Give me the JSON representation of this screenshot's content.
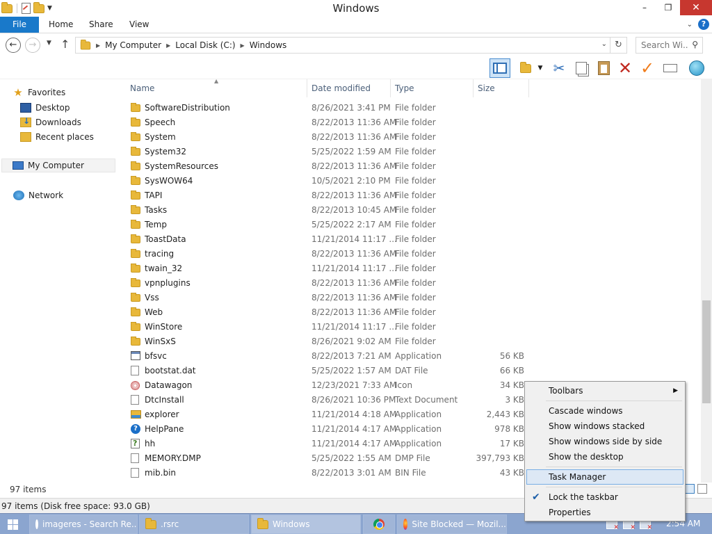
{
  "window": {
    "title": "Windows",
    "minimize_glyph": "–",
    "maximize_glyph": "❐",
    "close_glyph": "✕"
  },
  "ribbon": {
    "tabs": [
      "File",
      "Home",
      "Share",
      "View"
    ]
  },
  "address": {
    "breadcrumbs": [
      "My Computer",
      "Local Disk (C:)",
      "Windows"
    ],
    "search_placeholder": "Search Wi..."
  },
  "toolbar": {
    "icons": [
      "layout-pane-icon",
      "new-folder-icon",
      "cut-icon",
      "copy-icon",
      "paste-icon",
      "delete-icon",
      "properties-check-icon",
      "rename-icon",
      "globe-icon"
    ]
  },
  "navpane": {
    "favorites": "Favorites",
    "items": [
      "Desktop",
      "Downloads",
      "Recent places"
    ],
    "computer": "My Computer",
    "network": "Network"
  },
  "columns": {
    "name": "Name",
    "date": "Date modified",
    "type": "Type",
    "size": "Size"
  },
  "files": [
    {
      "name": "SoftwareDistribution",
      "date": "8/26/2021 3:41 PM",
      "type": "File folder",
      "size": "",
      "icon": "folder"
    },
    {
      "name": "Speech",
      "date": "8/22/2013 11:36 AM",
      "type": "File folder",
      "size": "",
      "icon": "folder"
    },
    {
      "name": "System",
      "date": "8/22/2013 11:36 AM",
      "type": "File folder",
      "size": "",
      "icon": "folder"
    },
    {
      "name": "System32",
      "date": "5/25/2022 1:59 AM",
      "type": "File folder",
      "size": "",
      "icon": "folder"
    },
    {
      "name": "SystemResources",
      "date": "8/22/2013 11:36 AM",
      "type": "File folder",
      "size": "",
      "icon": "folder"
    },
    {
      "name": "SysWOW64",
      "date": "10/5/2021 2:10 PM",
      "type": "File folder",
      "size": "",
      "icon": "folder"
    },
    {
      "name": "TAPI",
      "date": "8/22/2013 11:36 AM",
      "type": "File folder",
      "size": "",
      "icon": "folder"
    },
    {
      "name": "Tasks",
      "date": "8/22/2013 10:45 AM",
      "type": "File folder",
      "size": "",
      "icon": "folder"
    },
    {
      "name": "Temp",
      "date": "5/25/2022 2:17 AM",
      "type": "File folder",
      "size": "",
      "icon": "folder"
    },
    {
      "name": "ToastData",
      "date": "11/21/2014 11:17 ...",
      "type": "File folder",
      "size": "",
      "icon": "folder"
    },
    {
      "name": "tracing",
      "date": "8/22/2013 11:36 AM",
      "type": "File folder",
      "size": "",
      "icon": "folder"
    },
    {
      "name": "twain_32",
      "date": "11/21/2014 11:17 ...",
      "type": "File folder",
      "size": "",
      "icon": "folder"
    },
    {
      "name": "vpnplugins",
      "date": "8/22/2013 11:36 AM",
      "type": "File folder",
      "size": "",
      "icon": "folder"
    },
    {
      "name": "Vss",
      "date": "8/22/2013 11:36 AM",
      "type": "File folder",
      "size": "",
      "icon": "folder"
    },
    {
      "name": "Web",
      "date": "8/22/2013 11:36 AM",
      "type": "File folder",
      "size": "",
      "icon": "folder"
    },
    {
      "name": "WinStore",
      "date": "11/21/2014 11:17 ...",
      "type": "File folder",
      "size": "",
      "icon": "folder"
    },
    {
      "name": "WinSxS",
      "date": "8/26/2021 9:02 AM",
      "type": "File folder",
      "size": "",
      "icon": "folder"
    },
    {
      "name": "bfsvc",
      "date": "8/22/2013 7:21 AM",
      "type": "Application",
      "size": "56 KB",
      "icon": "app"
    },
    {
      "name": "bootstat.dat",
      "date": "5/25/2022 1:57 AM",
      "type": "DAT File",
      "size": "66 KB",
      "icon": "page"
    },
    {
      "name": "Datawagon",
      "date": "12/23/2021 7:33 AM",
      "type": "Icon",
      "size": "34 KB",
      "icon": "icofile"
    },
    {
      "name": "DtcInstall",
      "date": "8/26/2021 10:36 PM",
      "type": "Text Document",
      "size": "3 KB",
      "icon": "page"
    },
    {
      "name": "explorer",
      "date": "11/21/2014 4:18 AM",
      "type": "Application",
      "size": "2,443 KB",
      "icon": "exp"
    },
    {
      "name": "HelpPane",
      "date": "11/21/2014 4:17 AM",
      "type": "Application",
      "size": "978 KB",
      "icon": "help"
    },
    {
      "name": "hh",
      "date": "11/21/2014 4:17 AM",
      "type": "Application",
      "size": "17 KB",
      "icon": "hh"
    },
    {
      "name": "MEMORY.DMP",
      "date": "5/25/2022 1:55 AM",
      "type": "DMP File",
      "size": "397,793 KB",
      "icon": "page"
    },
    {
      "name": "mib.bin",
      "date": "8/22/2013 3:01 AM",
      "type": "BIN File",
      "size": "43 KB",
      "icon": "page"
    }
  ],
  "status": {
    "item_count": "97 items",
    "info": "97 items (Disk free space: 93.0 GB)"
  },
  "taskbar": {
    "buttons": [
      {
        "label": "imageres - Search Re...",
        "icon": "search-icon"
      },
      {
        "label": ".rsrc",
        "icon": "folder-icon"
      },
      {
        "label": "Windows",
        "icon": "folder-icon"
      },
      {
        "label": "",
        "icon": "chrome-icon"
      },
      {
        "label": "Site Blocked — Mozil...",
        "icon": "firefox-icon"
      }
    ],
    "clock": "2:54 AM"
  },
  "context_menu": {
    "toolbars": "Toolbars",
    "cascade": "Cascade windows",
    "stacked": "Show windows stacked",
    "side_by_side": "Show windows side by side",
    "show_desktop": "Show the desktop",
    "task_manager": "Task Manager",
    "lock_taskbar": "Lock the taskbar",
    "properties": "Properties"
  }
}
